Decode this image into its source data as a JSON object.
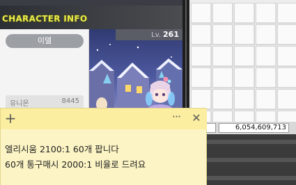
{
  "game_window": {
    "title": "CHARACTER INFO",
    "character_name": "이델",
    "level_prefix": "Lv.",
    "level": "261",
    "union_label": "유니온",
    "union_value": "8445"
  },
  "inventory_window": {
    "meso_value": "6,054,609,713"
  },
  "sticky_note": {
    "add_icon": "plus-icon",
    "menu_icon": "more-icon",
    "close_icon": "close-icon",
    "lines": [
      "엘리시움 2100:1 60개 팝니다",
      "60개 통구매시 2000:1 비율로 드려요"
    ]
  }
}
